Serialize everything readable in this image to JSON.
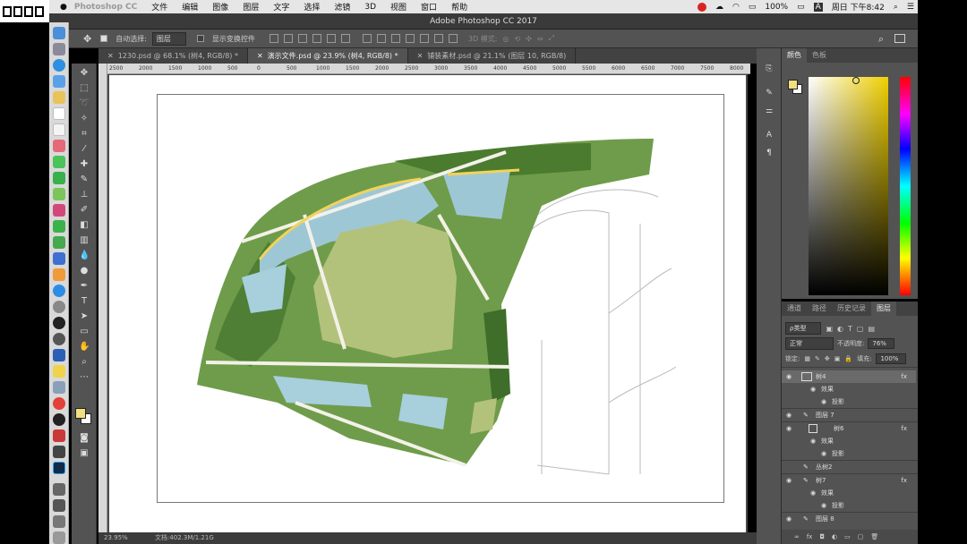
{
  "overlay_text": "□□□□□□□□□",
  "mac_menubar": {
    "apple": "",
    "app_name": "Photoshop CC",
    "menus": [
      "文件",
      "编辑",
      "图像",
      "图层",
      "文字",
      "选择",
      "滤镜",
      "3D",
      "视图",
      "窗口",
      "帮助"
    ],
    "battery": "100%",
    "input_badge": "A",
    "clock": "周日 下午8:42"
  },
  "window_title": "Adobe Photoshop CC 2017",
  "options_bar": {
    "auto_select_label": "自动选择:",
    "auto_select_value": "图层",
    "show_transform_label": "显示变换控件",
    "mode_3d_label": "3D 模式:"
  },
  "doc_tabs": [
    {
      "label": "1230.psd @ 68.1% (树4, RGB/8) *",
      "active": false
    },
    {
      "label": "演示文件.psd @ 23.9% (树4, RGB/8) *",
      "active": true
    },
    {
      "label": "铺装素材.psd @ 21.1% (图层 10, RGB/8)",
      "active": false
    }
  ],
  "ruler_ticks": [
    "2500",
    "2000",
    "1500",
    "1000",
    "500",
    "0",
    "500",
    "1000",
    "1500",
    "2000",
    "2500",
    "3000",
    "3500",
    "4000",
    "4500",
    "5000",
    "5500",
    "6000",
    "6500",
    "7000",
    "7500",
    "8000"
  ],
  "status": {
    "zoom": "23.95%",
    "doc_size": "文档:402.3M/1.21G"
  },
  "color_panel": {
    "tabs": [
      "颜色",
      "色板"
    ],
    "fg_color": "#f2df7f",
    "bg_color": "#ffffff"
  },
  "layers_panel": {
    "tabs": [
      "通道",
      "路径",
      "历史记录",
      "图层"
    ],
    "kind_filter": "ρ类型",
    "blend_mode": "正常",
    "opacity_label": "不透明度:",
    "opacity_value": "76%",
    "lock_label": "锁定:",
    "fill_label": "填充:",
    "fill_value": "100%",
    "layers": [
      "树4",
      "效果",
      "投影",
      "图层 7",
      "树6",
      "效果",
      "投影",
      "丛树2",
      "树7",
      "效果",
      "投影",
      "图层 8"
    ]
  },
  "colors": {
    "workspace": "#535353",
    "canvas": "#494949",
    "accent": "#f2df7f"
  }
}
